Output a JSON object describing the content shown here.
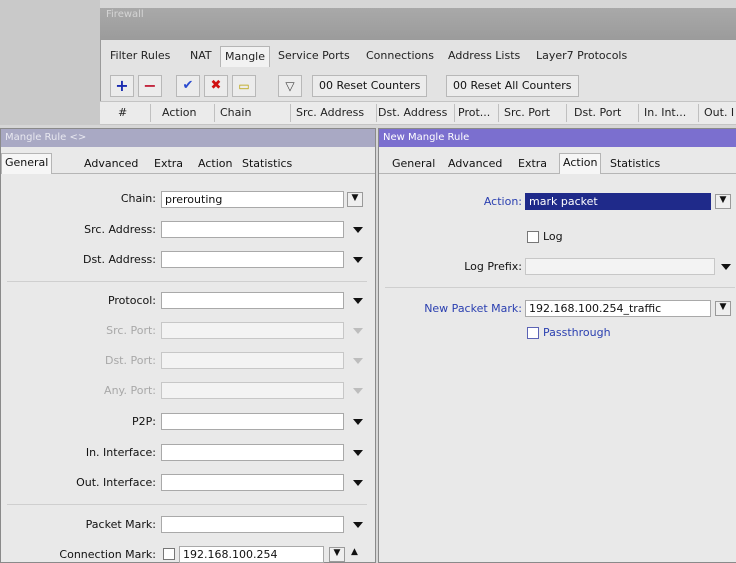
{
  "firewall": {
    "title": "Firewall",
    "tabs": [
      "Filter Rules",
      "NAT",
      "Mangle",
      "Service Ports",
      "Connections",
      "Address Lists",
      "Layer7 Protocols"
    ],
    "selected_tab": "Mangle",
    "toolbar": {
      "add_icon": "plus-icon",
      "remove_icon": "minus-icon",
      "enable_icon": "check-icon",
      "disable_icon": "x-icon",
      "comment_icon": "note-icon",
      "filter_icon": "funnel-icon",
      "reset_counters": "00 Reset Counters",
      "reset_all_counters": "00 Reset All Counters"
    },
    "columns": [
      "#",
      "Action",
      "Chain",
      "Src. Address",
      "Dst. Address",
      "Prot...",
      "Src. Port",
      "Dst. Port",
      "In. Int...",
      "Out. I"
    ]
  },
  "left_dialog": {
    "title": "Mangle Rule <>",
    "tabs": [
      "General",
      "Advanced",
      "Extra",
      "Action",
      "Statistics"
    ],
    "selected_tab": "General",
    "fields": {
      "chain": {
        "label": "Chain:",
        "value": "prerouting"
      },
      "src_address": {
        "label": "Src. Address:",
        "value": ""
      },
      "dst_address": {
        "label": "Dst. Address:",
        "value": ""
      },
      "protocol": {
        "label": "Protocol:",
        "value": ""
      },
      "src_port": {
        "label": "Src. Port:",
        "value": ""
      },
      "dst_port": {
        "label": "Dst. Port:",
        "value": ""
      },
      "any_port": {
        "label": "Any. Port:",
        "value": ""
      },
      "p2p": {
        "label": "P2P:",
        "value": ""
      },
      "in_interface": {
        "label": "In. Interface:",
        "value": ""
      },
      "out_interface": {
        "label": "Out. Interface:",
        "value": ""
      },
      "packet_mark": {
        "label": "Packet Mark:",
        "value": ""
      },
      "connection_mark": {
        "label": "Connection Mark:",
        "value": "192.168.100.254"
      }
    }
  },
  "right_dialog": {
    "title": "New Mangle Rule",
    "tabs": [
      "General",
      "Advanced",
      "Extra",
      "Action",
      "Statistics"
    ],
    "selected_tab": "Action",
    "action": {
      "label": "Action:",
      "value": "mark packet"
    },
    "log": {
      "label": "Log",
      "checked": false
    },
    "log_prefix": {
      "label": "Log Prefix:",
      "value": ""
    },
    "new_packet_mark": {
      "label": "New Packet Mark:",
      "value": "192.168.100.254_traffic"
    },
    "passthrough": {
      "label": "Passthrough",
      "checked": false
    }
  }
}
